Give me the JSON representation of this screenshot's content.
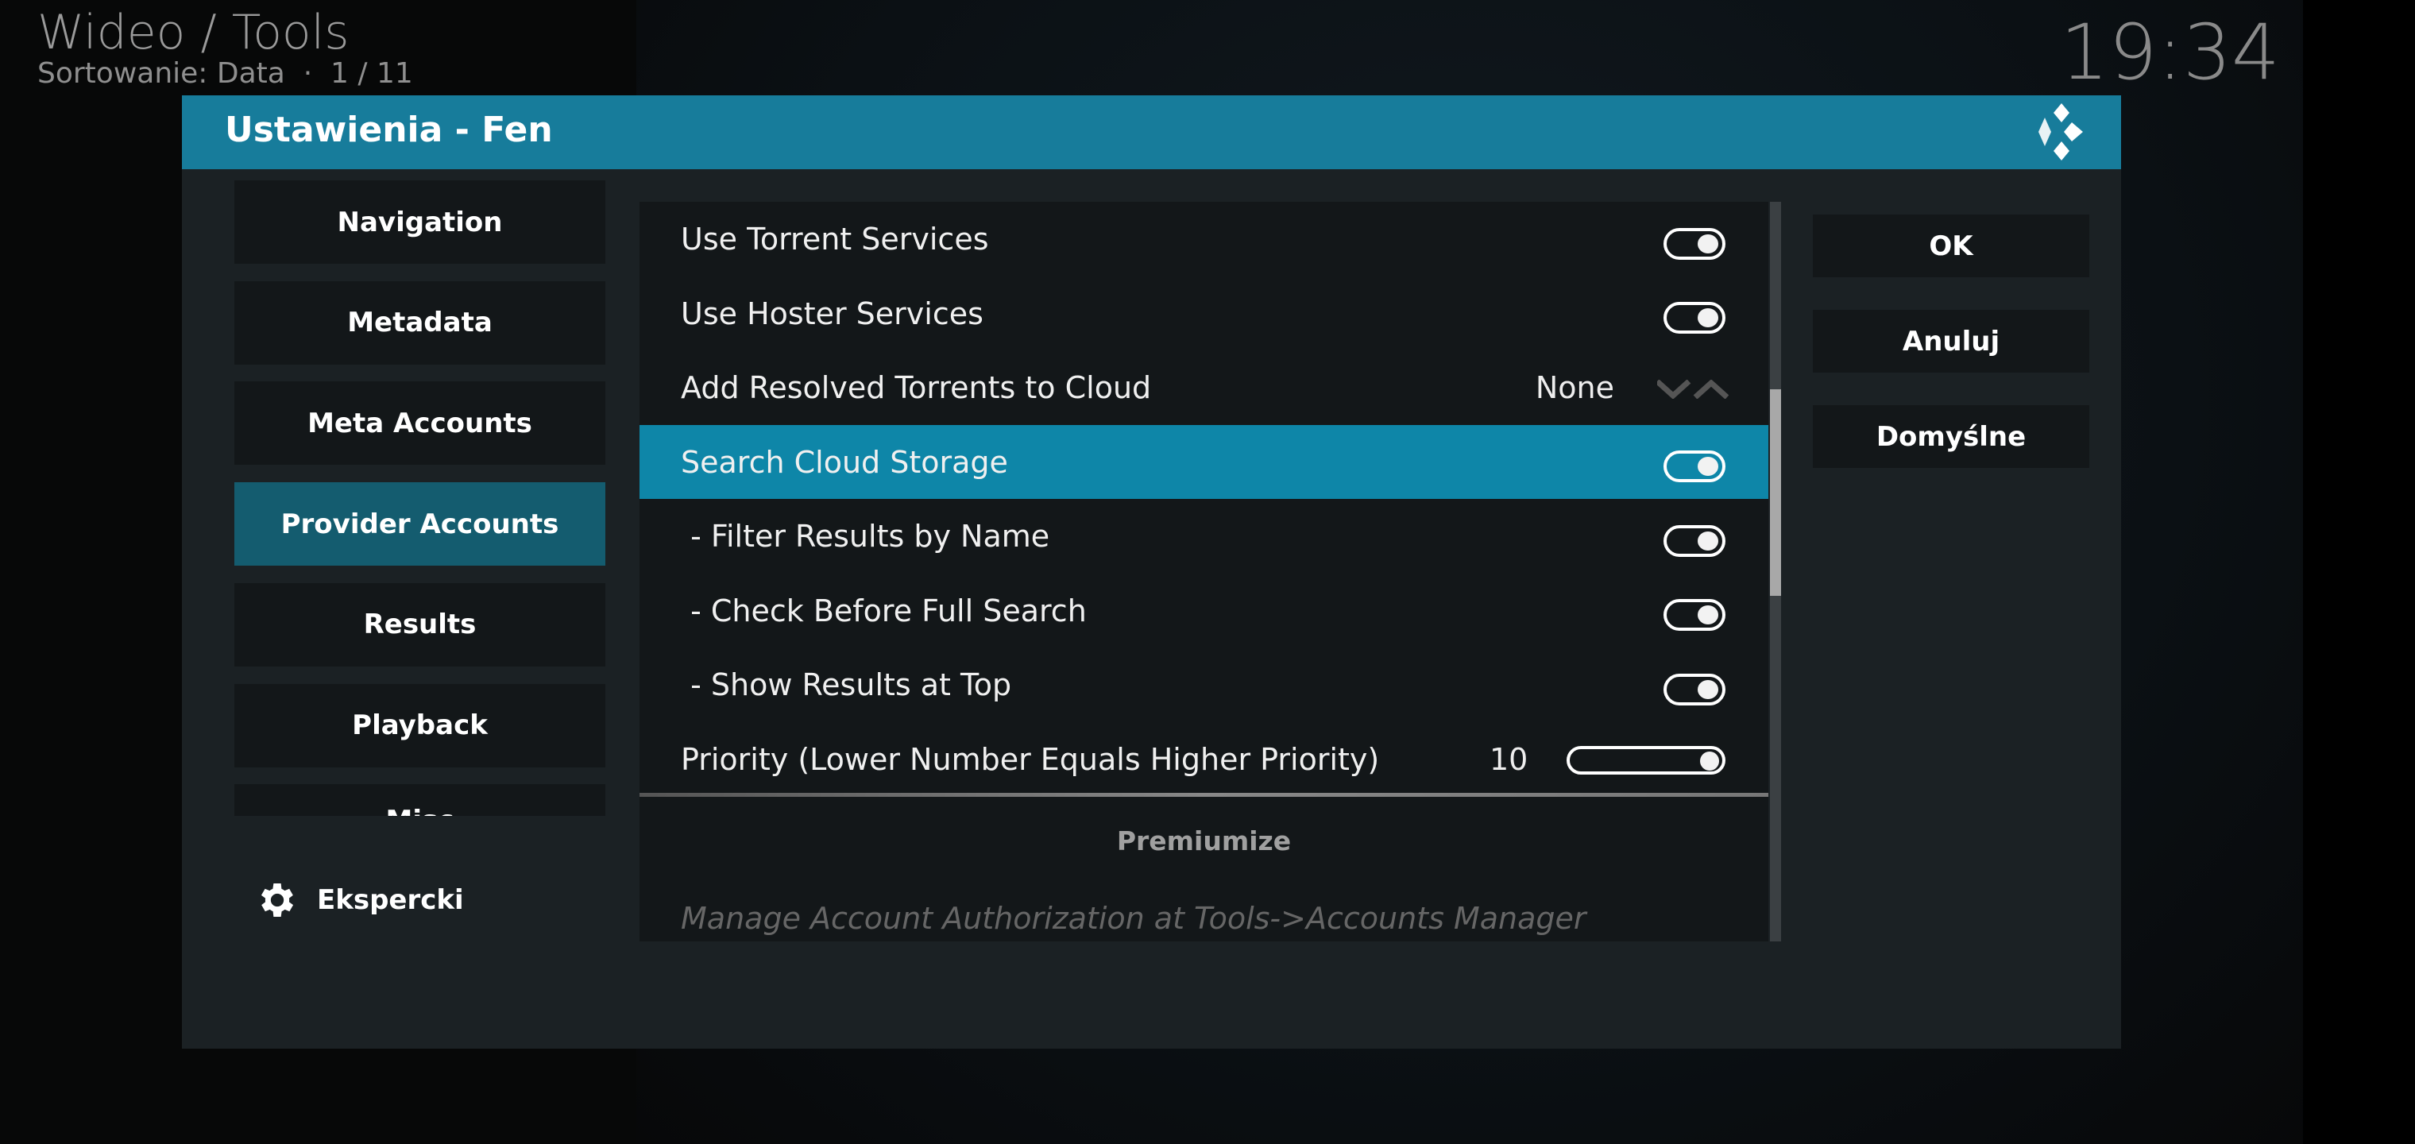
{
  "header": {
    "breadcrumb": "Wideo / Tools",
    "sort_info": "Sortowanie: Data  ·  1 / 11",
    "clock": "19:34"
  },
  "dialog": {
    "title": "Ustawienia - Fen",
    "accent": "#177c9b",
    "categories": [
      {
        "label": "Navigation"
      },
      {
        "label": "Metadata"
      },
      {
        "label": "Meta Accounts"
      },
      {
        "label": "Provider Accounts",
        "selected": true
      },
      {
        "label": "Results"
      },
      {
        "label": "Playback"
      },
      {
        "label": "Misc"
      }
    ],
    "level": {
      "label": "Ekspercki",
      "icon": "gear-icon"
    },
    "settings": [
      {
        "label": "Use Torrent Services",
        "type": "toggle",
        "value": true
      },
      {
        "label": "Use Hoster Services",
        "type": "toggle",
        "value": true
      },
      {
        "label": "Add Resolved Torrents to Cloud",
        "type": "spinner",
        "value": "None"
      },
      {
        "label": "Search Cloud Storage",
        "type": "toggle",
        "value": true,
        "focused": true
      },
      {
        "label": " - Filter Results by Name",
        "type": "toggle",
        "value": true
      },
      {
        "label": " - Check Before Full Search",
        "type": "toggle",
        "value": true
      },
      {
        "label": " - Show Results at Top",
        "type": "toggle",
        "value": true
      },
      {
        "label": "Priority (Lower Number Equals Higher Priority)",
        "type": "slider",
        "value": "10",
        "fraction": 1.0
      }
    ],
    "section_title": "Premiumize",
    "hint": "Manage Account Authorization at Tools->Accounts Manager",
    "buttons": [
      {
        "label": "OK"
      },
      {
        "label": "Anuluj"
      },
      {
        "label": "Domyślne"
      }
    ]
  }
}
